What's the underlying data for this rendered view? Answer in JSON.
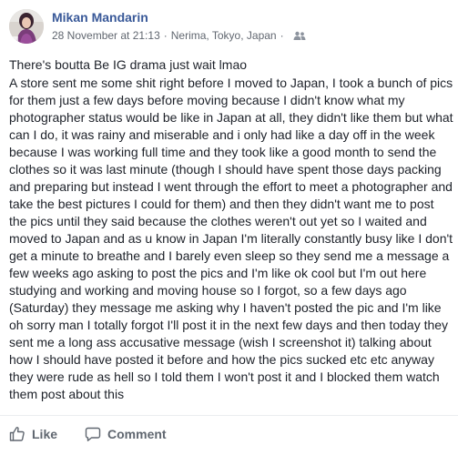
{
  "author": {
    "name": "Mikan Mandarin",
    "avatar_icon": "avatar-photo"
  },
  "meta": {
    "timestamp": "28 November at 21:13",
    "location": "Nerima, Tokyo, Japan",
    "separator": "·",
    "audience_icon": "friends-icon"
  },
  "post": {
    "headline": "There's boutta Be IG drama just wait lmao",
    "story": "A store sent me some shit right before I moved to Japan, I took a bunch of pics for them just a few days before moving because I didn't know what my photographer status would be like in Japan at all, they didn't like them but what can I do, it was rainy and miserable and i only had like a day off in the week because I was working full time and they took like a good month to send the clothes so it was last minute (though I should have spent those days packing and preparing but instead I went through the effort to meet a photographer and take the best pictures I could for them) and then they didn't want me to post the pics until they said because the clothes weren't out yet so I waited and moved to Japan and as u know in Japan I'm literally constantly busy like I don't get a minute to breathe and I barely even sleep so they send me a message a few weeks ago asking to post the pics and I'm like ok cool but I'm out here studying and working and moving house so I forgot, so a few days ago (Saturday) they message me asking why I haven't posted the pic and I'm like oh sorry man I totally forgot I'll post it in the next few days and then today they sent me a long ass accusative message (wish I screenshot it) talking about how I should have posted it before and how the pics sucked etc etc anyway they were rude as hell so I told them I won't post it and I blocked them watch them post about this"
  },
  "actions": {
    "like_label": "Like",
    "comment_label": "Comment"
  },
  "colors": {
    "author": "#385898",
    "meta": "#616770",
    "text": "#1d2129",
    "action": "#606770"
  }
}
